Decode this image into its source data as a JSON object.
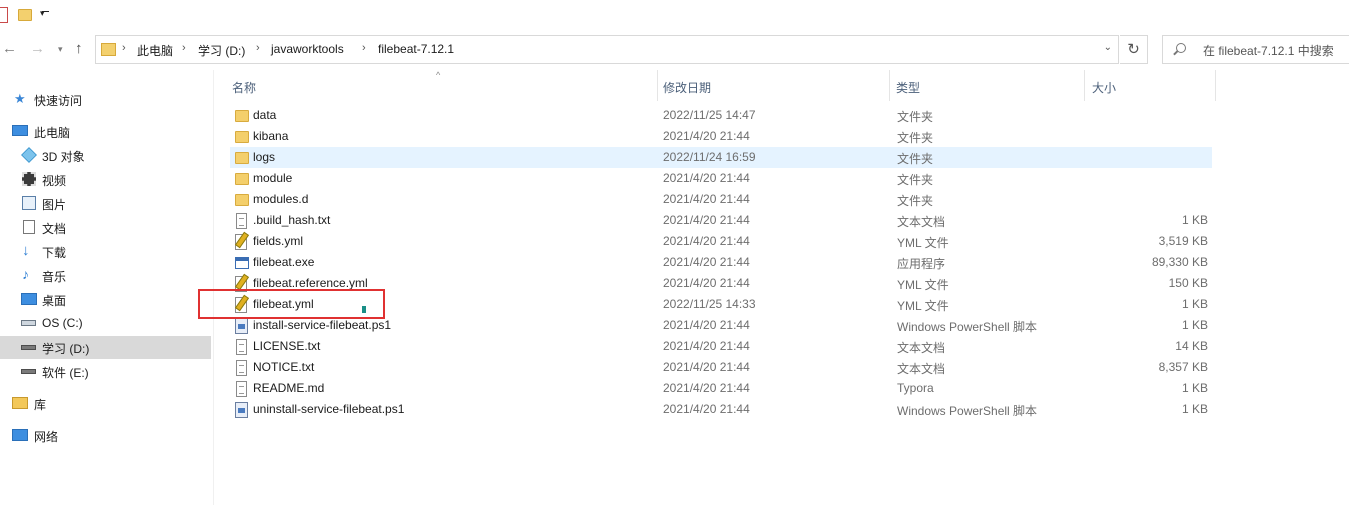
{
  "quick_access_toolbar": {
    "items": [
      "properties-icon",
      "new-folder-icon",
      "customize-dropdown-icon"
    ]
  },
  "nav": {
    "back_glyph": "←",
    "forward_glyph": "→",
    "recent_glyph": "▾",
    "up_glyph": "↑"
  },
  "address": {
    "crumbs": [
      "此电脑",
      "学习 (D:)",
      "javaworktools",
      "filebeat-7.12.1"
    ],
    "separator": "›",
    "dropdown_glyph": "⌄",
    "refresh_glyph": "↻"
  },
  "search": {
    "placeholder": "在 filebeat-7.12.1 中搜索"
  },
  "sidebar": {
    "items": [
      {
        "label": "快速访问",
        "icon": "star-icon"
      },
      {
        "label": "此电脑",
        "icon": "computer-icon"
      },
      {
        "label": "3D 对象",
        "icon": "3d-objects-icon"
      },
      {
        "label": "视频",
        "icon": "video-icon"
      },
      {
        "label": "图片",
        "icon": "pictures-icon"
      },
      {
        "label": "文档",
        "icon": "documents-icon"
      },
      {
        "label": "下载",
        "icon": "download-icon"
      },
      {
        "label": "音乐",
        "icon": "music-icon"
      },
      {
        "label": "桌面",
        "icon": "desktop-icon"
      },
      {
        "label": "OS (C:)",
        "icon": "drive-icon"
      },
      {
        "label": "学习 (D:)",
        "icon": "drive-icon",
        "selected": true
      },
      {
        "label": "软件 (E:)",
        "icon": "drive-icon"
      },
      {
        "label": "库",
        "icon": "library-icon"
      },
      {
        "label": "网络",
        "icon": "network-icon"
      }
    ]
  },
  "columns": {
    "name": "名称",
    "modified": "修改日期",
    "type": "类型",
    "size": "大小"
  },
  "files": [
    {
      "name": "data",
      "modified": "2022/11/25 14:47",
      "type": "文件夹",
      "size": "",
      "icon": "folder"
    },
    {
      "name": "kibana",
      "modified": "2021/4/20 21:44",
      "type": "文件夹",
      "size": "",
      "icon": "folder"
    },
    {
      "name": "logs",
      "modified": "2022/11/24 16:59",
      "type": "文件夹",
      "size": "",
      "icon": "folder",
      "hover": true
    },
    {
      "name": "module",
      "modified": "2021/4/20 21:44",
      "type": "文件夹",
      "size": "",
      "icon": "folder"
    },
    {
      "name": "modules.d",
      "modified": "2021/4/20 21:44",
      "type": "文件夹",
      "size": "",
      "icon": "folder"
    },
    {
      "name": ".build_hash.txt",
      "modified": "2021/4/20 21:44",
      "type": "文本文档",
      "size": "1 KB",
      "icon": "txt"
    },
    {
      "name": "fields.yml",
      "modified": "2021/4/20 21:44",
      "type": "YML 文件",
      "size": "3,519 KB",
      "icon": "yml"
    },
    {
      "name": "filebeat.exe",
      "modified": "2021/4/20 21:44",
      "type": "应用程序",
      "size": "89,330 KB",
      "icon": "exe"
    },
    {
      "name": "filebeat.reference.yml",
      "modified": "2021/4/20 21:44",
      "type": "YML 文件",
      "size": "150 KB",
      "icon": "yml"
    },
    {
      "name": "filebeat.yml",
      "modified": "2022/11/25 14:33",
      "type": "YML 文件",
      "size": "1 KB",
      "icon": "yml",
      "highlighted": true
    },
    {
      "name": "install-service-filebeat.ps1",
      "modified": "2021/4/20 21:44",
      "type": "Windows PowerShell 脚本",
      "size": "1 KB",
      "icon": "ps1"
    },
    {
      "name": "LICENSE.txt",
      "modified": "2021/4/20 21:44",
      "type": "文本文档",
      "size": "14 KB",
      "icon": "txt"
    },
    {
      "name": "NOTICE.txt",
      "modified": "2021/4/20 21:44",
      "type": "文本文档",
      "size": "8,357 KB",
      "icon": "txt"
    },
    {
      "name": "README.md",
      "modified": "2021/4/20 21:44",
      "type": "Typora",
      "size": "1 KB",
      "icon": "txt"
    },
    {
      "name": "uninstall-service-filebeat.ps1",
      "modified": "2021/4/20 21:44",
      "type": "Windows PowerShell 脚本",
      "size": "1 KB",
      "icon": "ps1"
    }
  ],
  "colors": {
    "hover_row": "#e5f3ff",
    "selected_sidebar": "#d9d9d9",
    "annotation_box": "#e03131",
    "header_text": "#4c607a"
  }
}
